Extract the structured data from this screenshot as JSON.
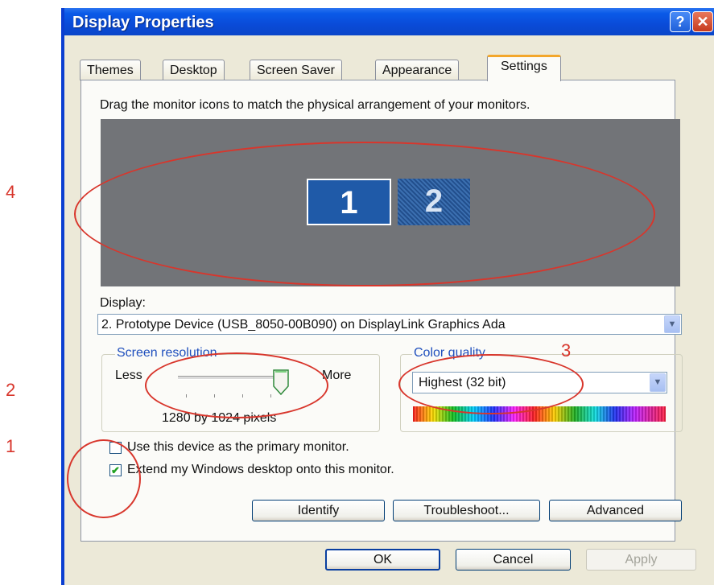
{
  "annotations": {
    "n1": "1",
    "n2": "2",
    "n3": "3",
    "n4": "4"
  },
  "window": {
    "title": "Display Properties",
    "help_glyph": "?",
    "close_glyph": "✕"
  },
  "tabs": [
    {
      "label": "Themes"
    },
    {
      "label": "Desktop"
    },
    {
      "label": "Screen Saver"
    },
    {
      "label": "Appearance"
    },
    {
      "label": "Settings",
      "active": true
    }
  ],
  "settings": {
    "instructions": "Drag the monitor icons to match the physical arrangement of your monitors.",
    "monitors": [
      {
        "label": "1"
      },
      {
        "label": "2"
      }
    ],
    "display_label": "Display:",
    "display_value": "2. Prototype Device (USB_8050-00B090) on DisplayLink Graphics Ada",
    "screen_resolution": {
      "legend": "Screen resolution",
      "less": "Less",
      "more": "More",
      "value_text": "1280 by 1024 pixels",
      "slider_level": 1.0
    },
    "color_quality": {
      "legend": "Color quality",
      "selected": "Highest (32 bit)"
    },
    "primary_checkbox": {
      "label": "Use this device as the primary monitor.",
      "checked": false
    },
    "extend_checkbox": {
      "label": "Extend my Windows desktop onto this monitor.",
      "checked": true
    },
    "buttons": {
      "identify": "Identify",
      "troubleshoot": "Troubleshoot...",
      "advanced": "Advanced"
    }
  },
  "footer": {
    "ok": "OK",
    "cancel": "Cancel",
    "apply": "Apply"
  },
  "colors": {
    "title_bar": "#0a4bd8",
    "accent_tab": "#f3a72c",
    "annotation": "#d8362c",
    "monitor_bg": "#727478"
  }
}
